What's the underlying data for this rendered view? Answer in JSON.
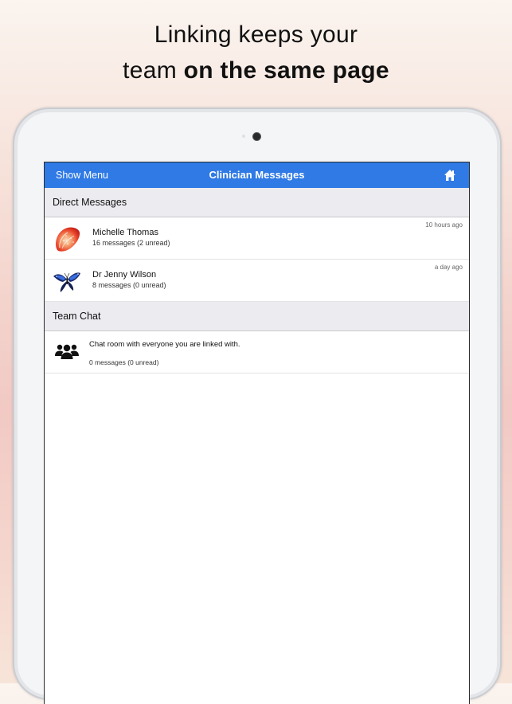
{
  "headline": {
    "line1": "Linking keeps your",
    "line2_prefix": "team ",
    "line2_bold": "on the same page"
  },
  "navbar": {
    "menu_label": "Show Menu",
    "title": "Clinician Messages",
    "home_icon": "home-icon",
    "color": "#2f7ae5"
  },
  "direct_messages": {
    "header": "Direct Messages",
    "items": [
      {
        "name": "Michelle Thomas",
        "summary": "16 messages (2 unread)",
        "time": "10 hours ago",
        "avatar": "strawberry-icon"
      },
      {
        "name": "Dr Jenny Wilson",
        "summary": "8 messages (0 unread)",
        "time": "a day ago",
        "avatar": "butterfly-icon"
      }
    ]
  },
  "team_chat": {
    "header": "Team Chat",
    "description": "Chat room with everyone you are linked with.",
    "summary": "0 messages (0 unread)",
    "avatar": "group-icon"
  }
}
